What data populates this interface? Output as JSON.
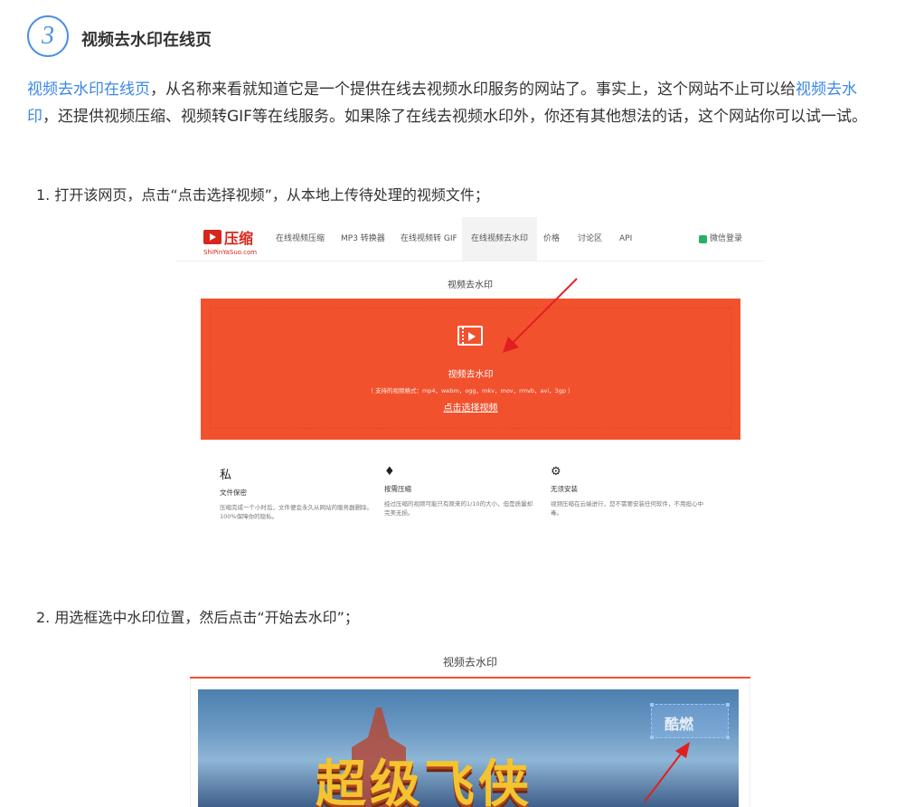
{
  "section": {
    "number": "3",
    "title": "视频去水印在线页"
  },
  "intro": {
    "link1": "视频去水印在线页",
    "text1": "，从名称来看就知道它是一个提供在线去视频水印服务的网站了。事实上，这个网站不止可以给",
    "link2": "视频去水印",
    "text2": "，还提供视频压缩、视频转GIF等在线服务。如果除了在线去视频水印外，你还有其他想法的话，这个网站你可以试一试。"
  },
  "steps": [
    "1. 打开该网页，点击“点击选择视频”，从本地上传待处理的视频文件；",
    "2. 用选框选中水印位置，然后点击“开始去水印”；"
  ],
  "screenshot1": {
    "logo_text": "压缩",
    "logo_sub": "ShiPinYaSuo.com",
    "nav": [
      "在线视频压缩",
      "MP3 转换器",
      "在线视频转 GIF",
      "在线视频去水印",
      "价格",
      "讨论区",
      "API"
    ],
    "login": "微信登录",
    "page_title": "视频去水印",
    "upload_title": "视频去水印",
    "upload_formats": "（ 支持的视频格式：mp4，webm，ogg，mkv，mov，rmvb，avi，3gp ）",
    "upload_link": "点击选择视频",
    "features": [
      {
        "icon": "私",
        "title": "文件保密",
        "desc": "压缩完成一个小时后，文件便会永久从网站的服务器删除。100%保障你的隐私。"
      },
      {
        "icon": "♦",
        "title": "按需压缩",
        "desc": "经过压缩的视频可能只有原来的1/10的大小，但是质量却完美无损。"
      },
      {
        "icon": "⚙",
        "title": "无须安装",
        "desc": "视频压缩在云端进行，您不需要安装任何软件，不用担心中毒。"
      }
    ],
    "accent_color": "#f2512d"
  },
  "screenshot2": {
    "page_title": "视频去水印",
    "game_title": "超级飞侠",
    "watermark_text": "酷燃"
  }
}
